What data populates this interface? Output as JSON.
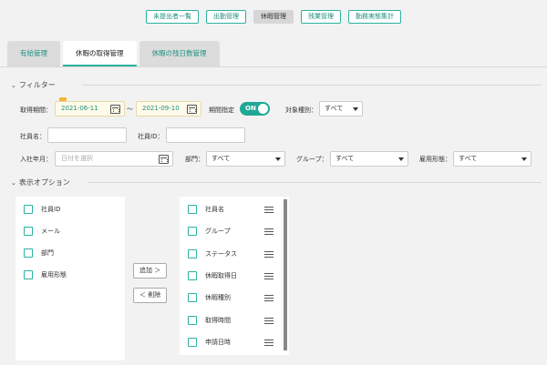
{
  "top_nav": {
    "items": [
      "未提出者一覧",
      "出勤管理",
      "休暇管理",
      "残業管理",
      "勤務実態集計"
    ],
    "active_index": 2
  },
  "tabs": {
    "items": [
      "有給管理",
      "休暇の取得管理",
      "休暇の残日数管理"
    ],
    "active_index": 1
  },
  "filter": {
    "title": "フィルター",
    "period_label": "取得期間：",
    "date_from": "2021-06-11",
    "date_separator": "～",
    "date_to": "2021-09-10",
    "period_spec_label": "期間指定",
    "period_toggle": "ON",
    "target_type_label": "対象種別：",
    "target_type_value": "すべて",
    "employee_name_label": "社員名：",
    "employee_name_value": "",
    "employee_id_label": "社員ID：",
    "employee_id_value": "",
    "join_month_label": "入社年月：",
    "join_month_placeholder": "日付を選択",
    "department_label": "部門：",
    "department_value": "すべて",
    "group_label": "グループ：",
    "group_value": "すべて",
    "employment_label": "雇用形態：",
    "employment_value": "すべて"
  },
  "display_options": {
    "title": "表示オプション",
    "available": [
      "社員ID",
      "メール",
      "部門",
      "雇用形態"
    ],
    "selected": [
      "社員名",
      "グループ",
      "ステータス",
      "休暇取得日",
      "休暇種別",
      "取得時間",
      "申請日時"
    ],
    "add_label": "追加 ＞",
    "remove_label": "＜ 削除"
  },
  "colors": {
    "accent": "#2bb3a0",
    "toggle": "#1fa896",
    "date_bg": "#fffbea"
  }
}
